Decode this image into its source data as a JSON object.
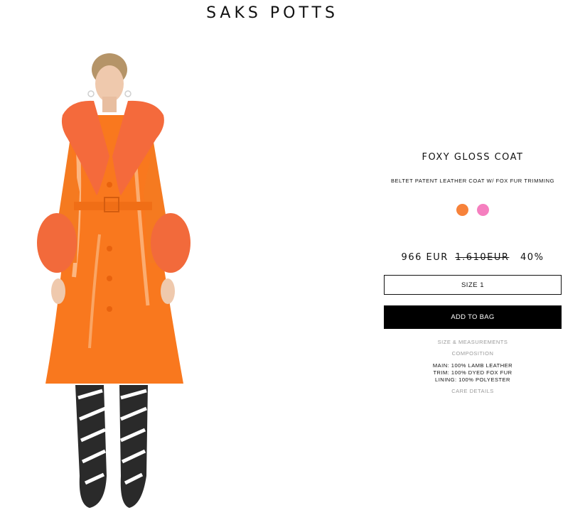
{
  "brand": {
    "name": "SAKS POTTS"
  },
  "product": {
    "title": "FOXY GLOSS COAT",
    "subtitle": "BELTET PATENT LEATHER COAT W/ FOX FUR TRIMMING",
    "colors": [
      {
        "name": "orange",
        "hex": "#f7823a"
      },
      {
        "name": "pink",
        "hex": "#f57fbf"
      }
    ],
    "price": {
      "current": "966 EUR",
      "original": "1.610EUR",
      "discount": "40%"
    },
    "size_label": "SIZE 1",
    "add_to_bag_label": "ADD TO BAG",
    "size_measurements_label": "SIZE & MEASUREMENTS",
    "composition_label": "COMPOSITION",
    "composition": {
      "main": "MAIN: 100% LAMB LEATHER",
      "trim": "TRIM: 100% DYED FOX FUR",
      "lining": "LINING: 100% POLYESTER"
    },
    "care_details_label": "CARE DETAILS"
  }
}
